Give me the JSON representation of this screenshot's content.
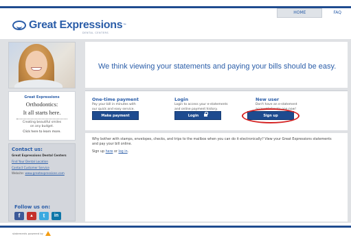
{
  "header": {
    "logo_text": "Great Expressions",
    "logo_tm": "™",
    "logo_sub": "DENTAL CENTERS",
    "nav_home": "HOME",
    "nav_faq": "FAQ"
  },
  "sidebar": {
    "promo": {
      "logo": "Great Expressions",
      "title_line1": "Orthodontics:",
      "title_line2": "It all starts here.",
      "small_line1": "Creating beautiful smiles",
      "small_line2": "on any budget.",
      "link": "Click here to learn more."
    },
    "contact": {
      "title": "Contact us:",
      "name": "Great Expressions Dental Centers",
      "link1": "Find Your Dental Location",
      "link2": "Contact Customer Service",
      "website_label": "Website:",
      "website_url": "www.greatexpressions.com"
    },
    "follow": {
      "title": "Follow us on:",
      "icons": [
        "f",
        "▲",
        "t",
        "in"
      ]
    }
  },
  "main": {
    "hero_text": "We think viewing your statements and paying your bills should be easy.",
    "cards": [
      {
        "title": "One-time payment",
        "desc_line1": "Pay your bill in minutes with",
        "desc_line2": "our quick and easy service.",
        "button": "Make payment"
      },
      {
        "title": "Login",
        "desc_line1": "Login to access your e-statements",
        "desc_line2": "and online payment history.",
        "button": "Login"
      },
      {
        "title": "New user",
        "desc_line1": "Don't have an e-statement",
        "desc_line2": "account? Create one now!",
        "button": "Sign up"
      }
    ],
    "info_text": "Why bother with stamps, envelopes, checks, and trips to the mailbox when you can do it electronically? View your Great Expressions statements and pay your bill online.",
    "info_signup_prefix": "Sign up",
    "info_signup_here": "here",
    "info_signup_or": "or",
    "info_signup_login": "log in",
    "info_signup_suffix": "."
  },
  "footer": {
    "text": "statements powered by"
  },
  "colors": {
    "brand_blue": "#2a5da8",
    "button_blue": "#1e4b8f",
    "highlight_red": "#d42121",
    "facebook": "#3b5998",
    "youtube": "#c4302b",
    "twitter": "#3aa9e0",
    "linkedin": "#0e76a8"
  }
}
